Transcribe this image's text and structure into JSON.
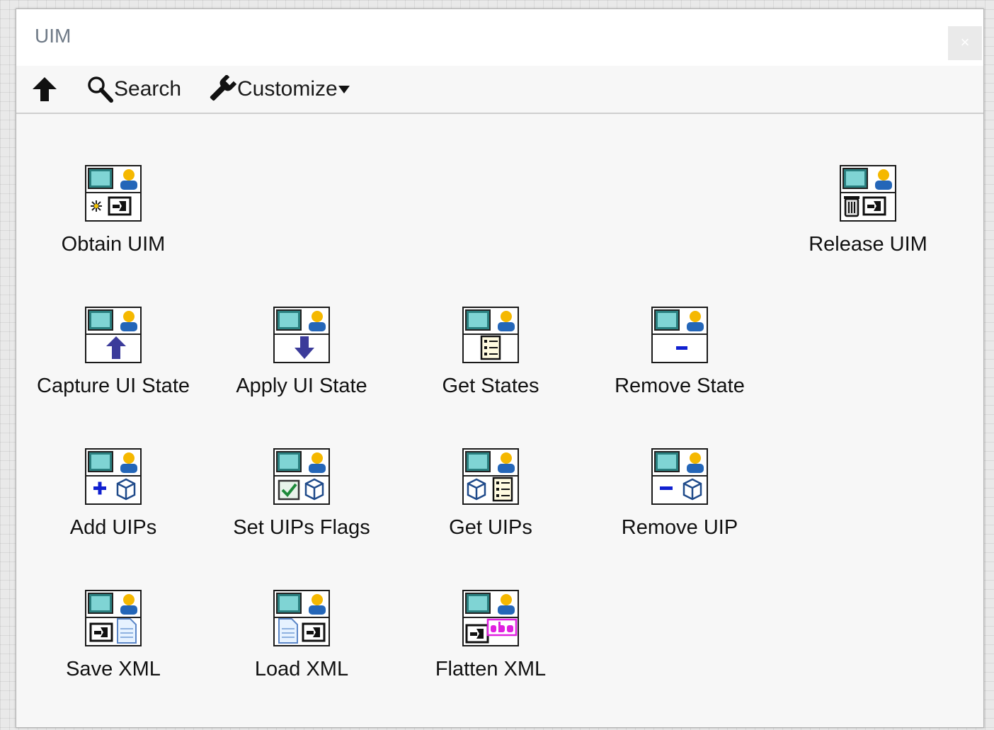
{
  "window": {
    "title": "UIM",
    "close_label": "×"
  },
  "toolbar": {
    "search_label": "Search",
    "customize_label": "Customize"
  },
  "items": [
    {
      "label": "Obtain UIM",
      "icon": "obtain-uim-icon"
    },
    {
      "label": "Release UIM",
      "icon": "release-uim-icon"
    },
    {
      "label": "Capture UI State",
      "icon": "capture-ui-state-icon"
    },
    {
      "label": "Apply UI State",
      "icon": "apply-ui-state-icon"
    },
    {
      "label": "Get States",
      "icon": "get-states-icon"
    },
    {
      "label": "Remove State",
      "icon": "remove-state-icon"
    },
    {
      "label": "Add UIPs",
      "icon": "add-uips-icon"
    },
    {
      "label": "Set UIPs Flags",
      "icon": "set-uips-flags-icon"
    },
    {
      "label": "Get UIPs",
      "icon": "get-uips-icon"
    },
    {
      "label": "Remove UIP",
      "icon": "remove-uip-icon"
    },
    {
      "label": "Save XML",
      "icon": "save-xml-icon"
    },
    {
      "label": "Load XML",
      "icon": "load-xml-icon"
    },
    {
      "label": "Flatten XML",
      "icon": "flatten-xml-icon"
    }
  ]
}
